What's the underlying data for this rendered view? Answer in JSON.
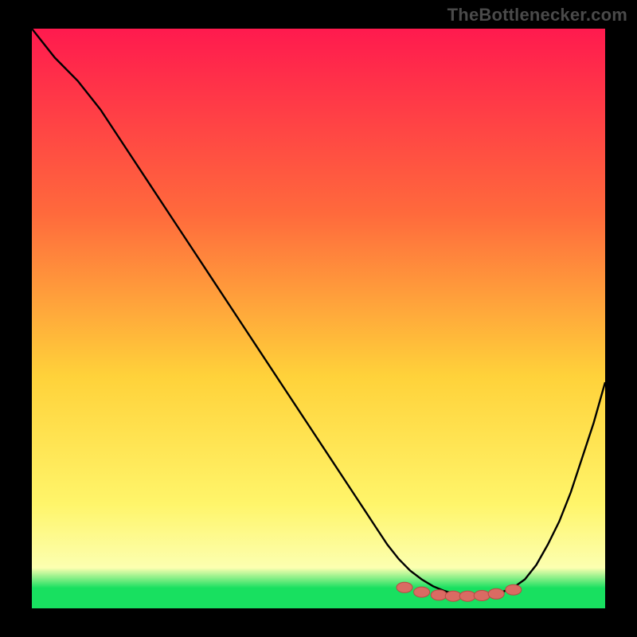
{
  "branding": {
    "label": "TheBottlenecker.com"
  },
  "colors": {
    "background": "#000000",
    "gradient_top": "#ff1a4e",
    "gradient_mid_upper": "#ff6a3c",
    "gradient_mid": "#ffd23a",
    "gradient_low": "#fff56a",
    "gradient_paleyellow": "#fcffb0",
    "gradient_green": "#18e060",
    "curve": "#000000",
    "marker_fill": "#da6b63",
    "marker_stroke": "#b84b44"
  },
  "chart_data": {
    "type": "line",
    "title": "",
    "xlabel": "",
    "ylabel": "",
    "xlim": [
      0,
      100
    ],
    "ylim": [
      0,
      100
    ],
    "series": [
      {
        "name": "bottleneck-curve",
        "x": [
          0,
          4,
          8,
          12,
          16,
          20,
          24,
          28,
          32,
          36,
          40,
          44,
          48,
          52,
          56,
          58,
          60,
          62,
          64,
          66,
          68,
          70,
          72,
          74,
          76,
          78,
          80,
          82,
          84,
          86,
          88,
          90,
          92,
          94,
          96,
          98,
          100
        ],
        "y": [
          100,
          95,
          91,
          86,
          80,
          74,
          68,
          62,
          56,
          50,
          44,
          38,
          32,
          26,
          20,
          17,
          14,
          11,
          8.5,
          6.5,
          5,
          3.8,
          3,
          2.4,
          2.2,
          2.2,
          2.4,
          2.8,
          3.6,
          5,
          7.5,
          11,
          15,
          20,
          26,
          32,
          39
        ]
      }
    ],
    "markers": {
      "name": "highlight-points",
      "x": [
        65,
        68,
        71,
        73.5,
        76,
        78.5,
        81,
        84
      ],
      "y": [
        3.6,
        2.8,
        2.3,
        2.1,
        2.1,
        2.2,
        2.5,
        3.2
      ]
    }
  }
}
